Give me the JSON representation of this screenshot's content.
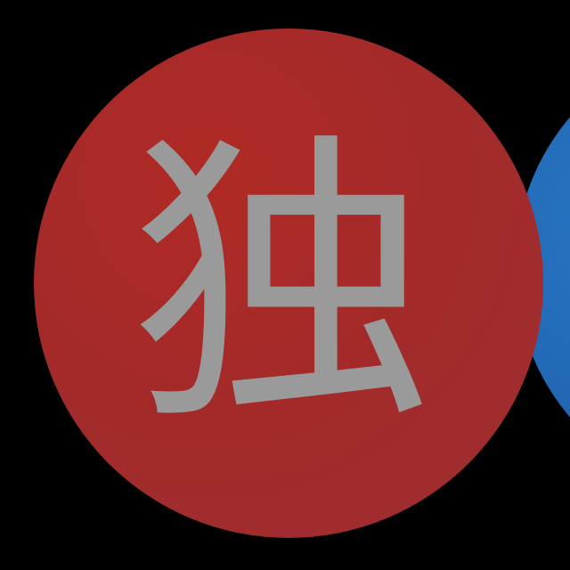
{
  "badges": [
    {
      "glyph": "独",
      "background_color": "#a52b2b",
      "glyph_color": "#9a9a9a"
    },
    {
      "glyph": "",
      "background_color": "#1f63ae"
    }
  ]
}
